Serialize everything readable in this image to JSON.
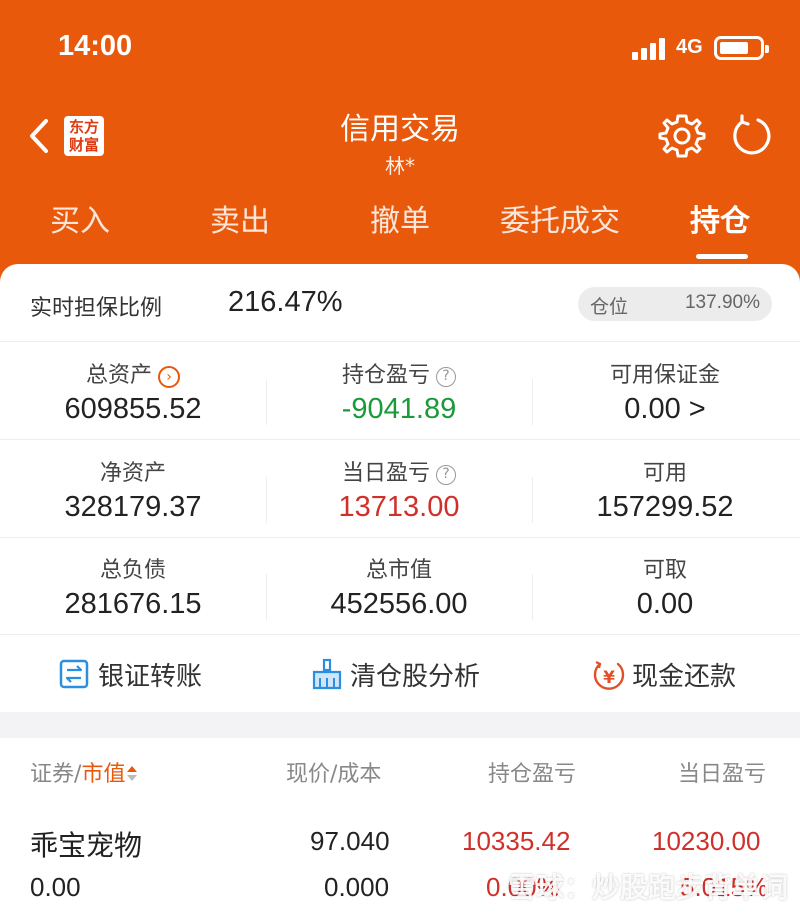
{
  "status_bar": {
    "time": "14:00",
    "network": "4G"
  },
  "nav": {
    "logo_line1": "东方",
    "logo_line2": "财富",
    "title": "信用交易",
    "subtitle": "林*"
  },
  "tabs": [
    {
      "label": "买入"
    },
    {
      "label": "卖出"
    },
    {
      "label": "撤单"
    },
    {
      "label": "委托成交"
    },
    {
      "label": "持仓",
      "active": true
    }
  ],
  "ratio": {
    "label": "实时担保比例",
    "value": "216.47%",
    "position_label": "仓位",
    "position_value": "137.90%"
  },
  "summary": {
    "total_assets": {
      "label": "总资产",
      "value": "609855.52"
    },
    "holding_pl": {
      "label": "持仓盈亏",
      "value": "-9041.89"
    },
    "avail_margin": {
      "label": "可用保证金",
      "value": "0.00 >"
    },
    "net_assets": {
      "label": "净资产",
      "value": "328179.37"
    },
    "daily_pl": {
      "label": "当日盈亏",
      "value": "13713.00"
    },
    "available": {
      "label": "可用",
      "value": "157299.52"
    },
    "total_liab": {
      "label": "总负债",
      "value": "281676.15"
    },
    "market_value": {
      "label": "总市值",
      "value": "452556.00"
    },
    "withdrawable": {
      "label": "可取",
      "value": "0.00"
    }
  },
  "actions": [
    {
      "label": "银证转账",
      "icon": "transfer-icon"
    },
    {
      "label": "清仓股分析",
      "icon": "broom-icon"
    },
    {
      "label": "现金还款",
      "icon": "yuan-icon"
    }
  ],
  "table": {
    "col_security": "证券",
    "col_slash": "/",
    "col_market_value": "市值",
    "col_price_cost": "现价/成本",
    "col_holding_pl": "持仓盈亏",
    "col_daily_pl": "当日盈亏",
    "rows": [
      {
        "name": "乖宝宠物",
        "market_value": "0.00",
        "price": "97.040",
        "cost": "0.000",
        "holding_pl": "10335.42",
        "holding_pl_pct": "0.00%",
        "daily_pl": "10230.00",
        "daily_pl_pct": "5.015%"
      }
    ]
  },
  "watermark": "雪球：炒股跑步背单词",
  "colors": {
    "brand": "#e8590c",
    "up": "#d0302a",
    "down": "#1a9a3a"
  }
}
